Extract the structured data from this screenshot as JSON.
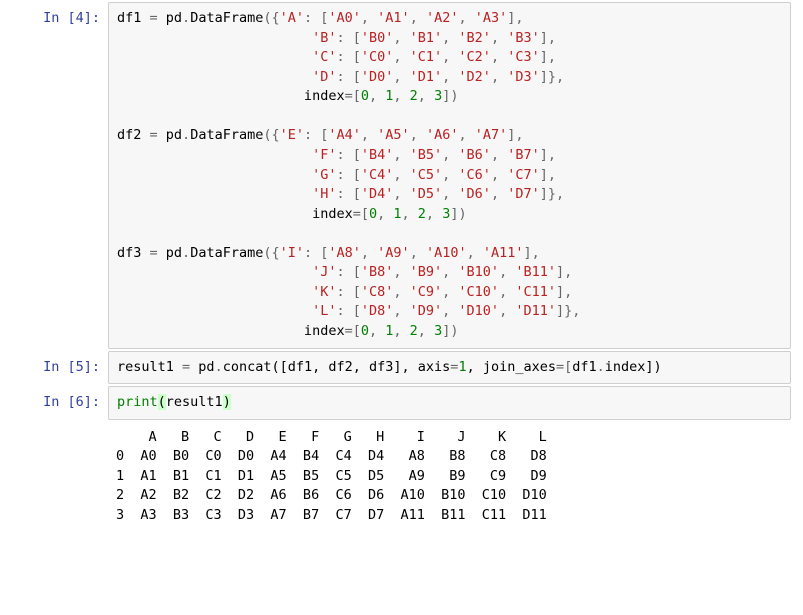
{
  "cells": [
    {
      "prompt": "In  [4]:",
      "type": "code",
      "tokens": [
        {
          "t": "df1 ",
          "c": "ident"
        },
        {
          "t": "=",
          "c": "op"
        },
        {
          "t": " pd",
          "c": "ident"
        },
        {
          "t": ".",
          "c": "op"
        },
        {
          "t": "DataFrame",
          "c": "ident"
        },
        {
          "t": "({",
          "c": "op"
        },
        {
          "t": "'A'",
          "c": "str"
        },
        {
          "t": ": [",
          "c": "op"
        },
        {
          "t": "'A0'",
          "c": "str"
        },
        {
          "t": ", ",
          "c": "op"
        },
        {
          "t": "'A1'",
          "c": "str"
        },
        {
          "t": ", ",
          "c": "op"
        },
        {
          "t": "'A2'",
          "c": "str"
        },
        {
          "t": ", ",
          "c": "op"
        },
        {
          "t": "'A3'",
          "c": "str"
        },
        {
          "t": "],\n",
          "c": "op"
        },
        {
          "t": "                        ",
          "c": "ident"
        },
        {
          "t": "'B'",
          "c": "str"
        },
        {
          "t": ": [",
          "c": "op"
        },
        {
          "t": "'B0'",
          "c": "str"
        },
        {
          "t": ", ",
          "c": "op"
        },
        {
          "t": "'B1'",
          "c": "str"
        },
        {
          "t": ", ",
          "c": "op"
        },
        {
          "t": "'B2'",
          "c": "str"
        },
        {
          "t": ", ",
          "c": "op"
        },
        {
          "t": "'B3'",
          "c": "str"
        },
        {
          "t": "],\n",
          "c": "op"
        },
        {
          "t": "                        ",
          "c": "ident"
        },
        {
          "t": "'C'",
          "c": "str"
        },
        {
          "t": ": [",
          "c": "op"
        },
        {
          "t": "'C0'",
          "c": "str"
        },
        {
          "t": ", ",
          "c": "op"
        },
        {
          "t": "'C1'",
          "c": "str"
        },
        {
          "t": ", ",
          "c": "op"
        },
        {
          "t": "'C2'",
          "c": "str"
        },
        {
          "t": ", ",
          "c": "op"
        },
        {
          "t": "'C3'",
          "c": "str"
        },
        {
          "t": "],\n",
          "c": "op"
        },
        {
          "t": "                        ",
          "c": "ident"
        },
        {
          "t": "'D'",
          "c": "str"
        },
        {
          "t": ": [",
          "c": "op"
        },
        {
          "t": "'D0'",
          "c": "str"
        },
        {
          "t": ", ",
          "c": "op"
        },
        {
          "t": "'D1'",
          "c": "str"
        },
        {
          "t": ", ",
          "c": "op"
        },
        {
          "t": "'D2'",
          "c": "str"
        },
        {
          "t": ", ",
          "c": "op"
        },
        {
          "t": "'D3'",
          "c": "str"
        },
        {
          "t": "]},\n",
          "c": "op"
        },
        {
          "t": "                       index",
          "c": "ident"
        },
        {
          "t": "=[",
          "c": "op"
        },
        {
          "t": "0",
          "c": "num"
        },
        {
          "t": ", ",
          "c": "op"
        },
        {
          "t": "1",
          "c": "num"
        },
        {
          "t": ", ",
          "c": "op"
        },
        {
          "t": "2",
          "c": "num"
        },
        {
          "t": ", ",
          "c": "op"
        },
        {
          "t": "3",
          "c": "num"
        },
        {
          "t": "])\n\n",
          "c": "op"
        },
        {
          "t": "df2 ",
          "c": "ident"
        },
        {
          "t": "=",
          "c": "op"
        },
        {
          "t": " pd",
          "c": "ident"
        },
        {
          "t": ".",
          "c": "op"
        },
        {
          "t": "DataFrame",
          "c": "ident"
        },
        {
          "t": "({",
          "c": "op"
        },
        {
          "t": "'E'",
          "c": "str"
        },
        {
          "t": ": [",
          "c": "op"
        },
        {
          "t": "'A4'",
          "c": "str"
        },
        {
          "t": ", ",
          "c": "op"
        },
        {
          "t": "'A5'",
          "c": "str"
        },
        {
          "t": ", ",
          "c": "op"
        },
        {
          "t": "'A6'",
          "c": "str"
        },
        {
          "t": ", ",
          "c": "op"
        },
        {
          "t": "'A7'",
          "c": "str"
        },
        {
          "t": "],\n",
          "c": "op"
        },
        {
          "t": "                        ",
          "c": "ident"
        },
        {
          "t": "'F'",
          "c": "str"
        },
        {
          "t": ": [",
          "c": "op"
        },
        {
          "t": "'B4'",
          "c": "str"
        },
        {
          "t": ", ",
          "c": "op"
        },
        {
          "t": "'B5'",
          "c": "str"
        },
        {
          "t": ", ",
          "c": "op"
        },
        {
          "t": "'B6'",
          "c": "str"
        },
        {
          "t": ", ",
          "c": "op"
        },
        {
          "t": "'B7'",
          "c": "str"
        },
        {
          "t": "],\n",
          "c": "op"
        },
        {
          "t": "                        ",
          "c": "ident"
        },
        {
          "t": "'G'",
          "c": "str"
        },
        {
          "t": ": [",
          "c": "op"
        },
        {
          "t": "'C4'",
          "c": "str"
        },
        {
          "t": ", ",
          "c": "op"
        },
        {
          "t": "'C5'",
          "c": "str"
        },
        {
          "t": ", ",
          "c": "op"
        },
        {
          "t": "'C6'",
          "c": "str"
        },
        {
          "t": ", ",
          "c": "op"
        },
        {
          "t": "'C7'",
          "c": "str"
        },
        {
          "t": "],\n",
          "c": "op"
        },
        {
          "t": "                        ",
          "c": "ident"
        },
        {
          "t": "'H'",
          "c": "str"
        },
        {
          "t": ": [",
          "c": "op"
        },
        {
          "t": "'D4'",
          "c": "str"
        },
        {
          "t": ", ",
          "c": "op"
        },
        {
          "t": "'D5'",
          "c": "str"
        },
        {
          "t": ", ",
          "c": "op"
        },
        {
          "t": "'D6'",
          "c": "str"
        },
        {
          "t": ", ",
          "c": "op"
        },
        {
          "t": "'D7'",
          "c": "str"
        },
        {
          "t": "]},\n",
          "c": "op"
        },
        {
          "t": "                        index",
          "c": "ident"
        },
        {
          "t": "=[",
          "c": "op"
        },
        {
          "t": "0",
          "c": "num"
        },
        {
          "t": ", ",
          "c": "op"
        },
        {
          "t": "1",
          "c": "num"
        },
        {
          "t": ", ",
          "c": "op"
        },
        {
          "t": "2",
          "c": "num"
        },
        {
          "t": ", ",
          "c": "op"
        },
        {
          "t": "3",
          "c": "num"
        },
        {
          "t": "])\n\n",
          "c": "op"
        },
        {
          "t": "df3 ",
          "c": "ident"
        },
        {
          "t": "=",
          "c": "op"
        },
        {
          "t": " pd",
          "c": "ident"
        },
        {
          "t": ".",
          "c": "op"
        },
        {
          "t": "DataFrame",
          "c": "ident"
        },
        {
          "t": "({",
          "c": "op"
        },
        {
          "t": "'I'",
          "c": "str"
        },
        {
          "t": ": [",
          "c": "op"
        },
        {
          "t": "'A8'",
          "c": "str"
        },
        {
          "t": ", ",
          "c": "op"
        },
        {
          "t": "'A9'",
          "c": "str"
        },
        {
          "t": ", ",
          "c": "op"
        },
        {
          "t": "'A10'",
          "c": "str"
        },
        {
          "t": ", ",
          "c": "op"
        },
        {
          "t": "'A11'",
          "c": "str"
        },
        {
          "t": "],\n",
          "c": "op"
        },
        {
          "t": "                        ",
          "c": "ident"
        },
        {
          "t": "'J'",
          "c": "str"
        },
        {
          "t": ": [",
          "c": "op"
        },
        {
          "t": "'B8'",
          "c": "str"
        },
        {
          "t": ", ",
          "c": "op"
        },
        {
          "t": "'B9'",
          "c": "str"
        },
        {
          "t": ", ",
          "c": "op"
        },
        {
          "t": "'B10'",
          "c": "str"
        },
        {
          "t": ", ",
          "c": "op"
        },
        {
          "t": "'B11'",
          "c": "str"
        },
        {
          "t": "],\n",
          "c": "op"
        },
        {
          "t": "                        ",
          "c": "ident"
        },
        {
          "t": "'K'",
          "c": "str"
        },
        {
          "t": ": [",
          "c": "op"
        },
        {
          "t": "'C8'",
          "c": "str"
        },
        {
          "t": ", ",
          "c": "op"
        },
        {
          "t": "'C9'",
          "c": "str"
        },
        {
          "t": ", ",
          "c": "op"
        },
        {
          "t": "'C10'",
          "c": "str"
        },
        {
          "t": ", ",
          "c": "op"
        },
        {
          "t": "'C11'",
          "c": "str"
        },
        {
          "t": "],\n",
          "c": "op"
        },
        {
          "t": "                        ",
          "c": "ident"
        },
        {
          "t": "'L'",
          "c": "str"
        },
        {
          "t": ": [",
          "c": "op"
        },
        {
          "t": "'D8'",
          "c": "str"
        },
        {
          "t": ", ",
          "c": "op"
        },
        {
          "t": "'D9'",
          "c": "str"
        },
        {
          "t": ", ",
          "c": "op"
        },
        {
          "t": "'D10'",
          "c": "str"
        },
        {
          "t": ", ",
          "c": "op"
        },
        {
          "t": "'D11'",
          "c": "str"
        },
        {
          "t": "]},\n",
          "c": "op"
        },
        {
          "t": "                       index",
          "c": "ident"
        },
        {
          "t": "=[",
          "c": "op"
        },
        {
          "t": "0",
          "c": "num"
        },
        {
          "t": ", ",
          "c": "op"
        },
        {
          "t": "1",
          "c": "num"
        },
        {
          "t": ", ",
          "c": "op"
        },
        {
          "t": "2",
          "c": "num"
        },
        {
          "t": ", ",
          "c": "op"
        },
        {
          "t": "3",
          "c": "num"
        },
        {
          "t": "])",
          "c": "op"
        }
      ]
    },
    {
      "prompt": "In  [5]:",
      "type": "code",
      "tokens": [
        {
          "t": "result1 ",
          "c": "ident"
        },
        {
          "t": "=",
          "c": "op"
        },
        {
          "t": " pd",
          "c": "ident"
        },
        {
          "t": ".",
          "c": "op"
        },
        {
          "t": "concat",
          "c": "ident"
        },
        {
          "t": "([df1, df2, df3], axis",
          "c": "ident"
        },
        {
          "t": "=",
          "c": "op"
        },
        {
          "t": "1",
          "c": "num"
        },
        {
          "t": ", join_axes",
          "c": "ident"
        },
        {
          "t": "=[",
          "c": "op"
        },
        {
          "t": "df1",
          "c": "ident"
        },
        {
          "t": ".",
          "c": "op"
        },
        {
          "t": "index])",
          "c": "ident"
        }
      ]
    },
    {
      "prompt": "In  [6]:",
      "type": "code",
      "tokens": [
        {
          "t": "print",
          "c": "print"
        },
        {
          "t": "(",
          "c": "paren-hl"
        },
        {
          "t": "result1",
          "c": "ident"
        },
        {
          "t": ")",
          "c": "paren-hl"
        }
      ]
    }
  ],
  "output": {
    "text": "    A   B   C   D   E   F   G   H    I    J    K    L\n0  A0  B0  C0  D0  A4  B4  C4  D4   A8   B8   C8   D8\n1  A1  B1  C1  D1  A5  B5  C5  D5   A9   B9   C9   D9\n2  A2  B2  C2  D2  A6  B6  C6  D6  A10  B10  C10  D10\n3  A3  B3  C3  D3  A7  B7  C7  D7  A11  B11  C11  D11"
  },
  "chart_data": {
    "type": "table",
    "columns": [
      "A",
      "B",
      "C",
      "D",
      "E",
      "F",
      "G",
      "H",
      "I",
      "J",
      "K",
      "L"
    ],
    "index": [
      0,
      1,
      2,
      3
    ],
    "rows": [
      [
        "A0",
        "B0",
        "C0",
        "D0",
        "A4",
        "B4",
        "C4",
        "D4",
        "A8",
        "B8",
        "C8",
        "D8"
      ],
      [
        "A1",
        "B1",
        "C1",
        "D1",
        "A5",
        "B5",
        "C5",
        "D5",
        "A9",
        "B9",
        "C9",
        "D9"
      ],
      [
        "A2",
        "B2",
        "C2",
        "D2",
        "A6",
        "B6",
        "C6",
        "D6",
        "A10",
        "B10",
        "C10",
        "D10"
      ],
      [
        "A3",
        "B3",
        "C3",
        "D3",
        "A7",
        "B7",
        "C7",
        "D7",
        "A11",
        "B11",
        "C11",
        "D11"
      ]
    ]
  }
}
